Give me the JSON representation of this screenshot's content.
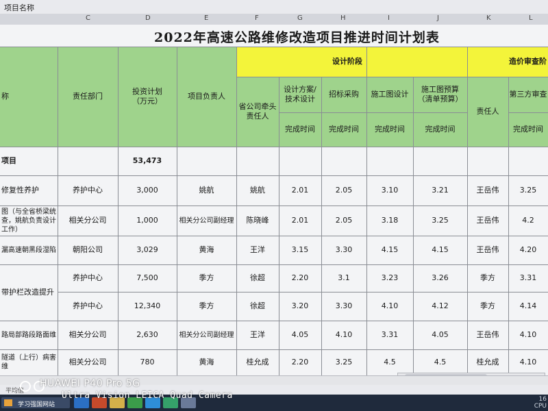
{
  "formula_bar": {
    "name_box": "项目名称"
  },
  "columns": [
    "C",
    "D",
    "E",
    "F",
    "G",
    "H",
    "I",
    "J",
    "K",
    "L"
  ],
  "sheet": {
    "title": "2022年高速公路维修改造项目推进时间计划表",
    "headers": {
      "name": "称",
      "dept": "责任部门",
      "invest": "投资计划\n（万元）",
      "leader": "项目负责人",
      "prov_lead": "省公司牵头\n责任人",
      "design_stage": "设计阶段",
      "cost_stage": "造价审查阶",
      "design_plan": "设计方案/\n技术设计",
      "bidding": "招标采购",
      "construction_design": "施工图设计",
      "construction_budget": "施工图预算\n（清单预算）",
      "responsible": "责任人",
      "third_party": "第三方审查",
      "finish_time": "完成时间"
    },
    "total": {
      "label": "项目",
      "invest": "53,473"
    },
    "rows": [
      {
        "name": "修复性养护",
        "dept": "养护中心",
        "invest": "3,000",
        "leader": "姚航",
        "prov": "姚航",
        "g": "2.01",
        "h": "2.05",
        "i": "3.10",
        "j": "3.21",
        "k": "王岳伟",
        "l": "3.25"
      },
      {
        "name": "图（与全省桥梁统\n查，姚航负责设计\n工作）",
        "dept": "相关分公司",
        "invest": "1,000",
        "leader": "相关分公司副经理",
        "prov": "陈晓峰",
        "g": "2.01",
        "h": "2.05",
        "i": "3.18",
        "j": "3.25",
        "k": "王岳伟",
        "l": "4.2"
      },
      {
        "name": "漏高速朝黑段湿陷",
        "dept": "朝阳公司",
        "invest": "3,029",
        "leader": "黄海",
        "prov": "王洋",
        "g": "3.15",
        "h": "3.30",
        "i": "4.15",
        "j": "4.15",
        "k": "王岳伟",
        "l": "4.20"
      },
      {
        "name": "",
        "dept": "养护中心",
        "invest": "7,500",
        "leader": "季方",
        "prov": "徐超",
        "g": "2.20",
        "h": "3.1",
        "i": "3.23",
        "j": "3.26",
        "k": "季方",
        "l": "3.31"
      },
      {
        "name": "",
        "dept": "养护中心",
        "invest": "12,340",
        "leader": "季方",
        "prov": "徐超",
        "g": "3.20",
        "h": "3.30",
        "i": "4.10",
        "j": "4.12",
        "k": "季方",
        "l": "4.14"
      },
      {
        "name": "路局部路段路面维",
        "dept": "相关分公司",
        "invest": "2,630",
        "leader": "相关分公司副经理",
        "prov": "王洋",
        "g": "4.05",
        "h": "4.10",
        "i": "3.31",
        "j": "4.05",
        "k": "王岳伟",
        "l": "4.10"
      },
      {
        "name": "隧道（上行）病害维",
        "dept": "相关分公司",
        "invest": "780",
        "leader": "黄海",
        "prov": "桂允成",
        "g": "2.20",
        "h": "3.25",
        "i": "4.5",
        "j": "4.5",
        "k": "桂允成",
        "l": "4.10"
      }
    ],
    "merged_name": "带护栏改造提升"
  },
  "taskbar": {
    "app_label": "学习强国网站"
  },
  "status": {
    "zoom_hint": "平均值"
  },
  "cpu": {
    "value": "16",
    "label": "CPU"
  },
  "watermark": {
    "line1": "HUAWEI P40 Pro 5G",
    "line2": "Ultra Vision LEICA Quad Camera"
  },
  "colors": {
    "green": "#9fd38c",
    "yellow": "#f3f43a"
  }
}
